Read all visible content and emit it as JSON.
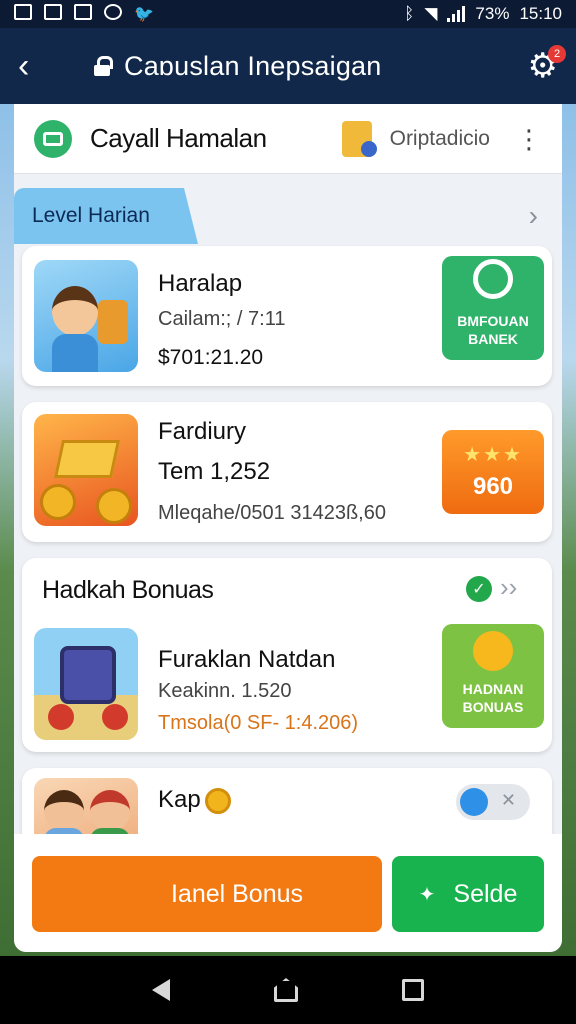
{
  "status_bar": {
    "battery": "73%",
    "time": "15:10"
  },
  "app_bar": {
    "title": "Caɒuslan Inepsaigan"
  },
  "header": {
    "name": "Cayall Hamalan",
    "crypto_label": "Oriptadicio"
  },
  "level": {
    "tab_label": "Level Harian"
  },
  "cards": [
    {
      "title": "Haralap",
      "subtitle": "Cailam:; / 7:11",
      "value": "$701:21.20",
      "action": "BMFOUAN BANEK"
    },
    {
      "title": "Fardiury",
      "subtitle": "Tem 1,252",
      "value": "Mleqahe/0501 31423ß,60",
      "action": "960"
    }
  ],
  "bonus": {
    "heading": "Hadkah Bonuas",
    "item": {
      "title": "Furaklan Natdan",
      "subtitle": "Keakinn. 1.520",
      "value": "Tmsola(0 SF- 1:4.206)",
      "action": "HADNAN BONUAS"
    }
  },
  "partial": {
    "title": "Kap"
  },
  "buttons": {
    "orange": "Ianel Bonus",
    "green": "Selde"
  },
  "colors": {
    "appbar": "#12284a",
    "orange": "#f37a12",
    "green": "#18b24e",
    "level_tab": "#7cc4f0"
  }
}
